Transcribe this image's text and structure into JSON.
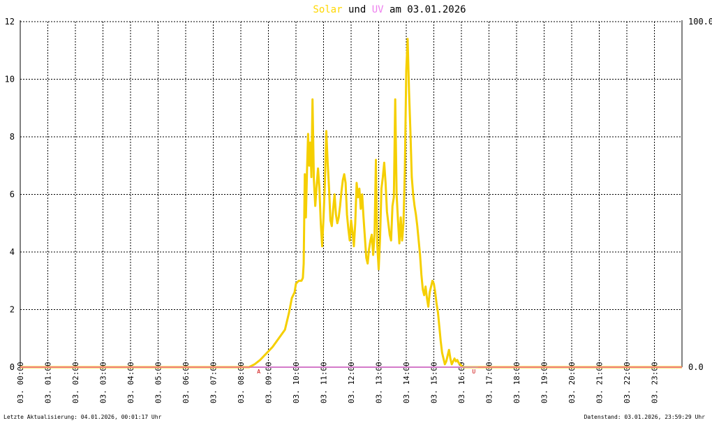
{
  "chart_data": {
    "type": "line",
    "title": {
      "solar": "Solar",
      "und": "und",
      "uv": "UV",
      "rest": "am 03.01.2026"
    },
    "colors": {
      "solar": "#f5cf00",
      "uv": "#d07ad6",
      "zero_line": "#f08080",
      "title_solar": "#ffd700",
      "title_uv": "#ee82ee",
      "marker": "#cc0000"
    },
    "y_left": {
      "min": 0,
      "max": 12,
      "ticks": [
        0,
        2,
        4,
        6,
        8,
        10,
        12
      ]
    },
    "y_right": {
      "ticks": [
        "0.0",
        "100.0"
      ]
    },
    "x_hours_range": [
      0,
      24
    ],
    "x_ticks": [
      "03. 00:00",
      "03. 01:00",
      "03. 02:00",
      "03. 03:00",
      "03. 04:00",
      "03. 05:00",
      "03. 06:00",
      "03. 07:00",
      "03. 08:00",
      "03. 09:00",
      "03. 10:00",
      "03. 11:00",
      "03. 12:00",
      "03. 13:00",
      "03. 14:00",
      "03. 15:00",
      "03. 16:00",
      "03. 17:00",
      "03. 18:00",
      "03. 19:00",
      "03. 20:00",
      "03. 21:00",
      "03. 22:00",
      "03. 23:00"
    ],
    "grid": true,
    "markers": [
      {
        "label": "A",
        "hour": 8.65
      },
      {
        "label": "U",
        "hour": 16.45
      }
    ],
    "series": [
      {
        "name": "Solar",
        "hours": [
          0,
          8.3,
          8.5,
          8.7,
          8.85,
          9.0,
          9.15,
          9.3,
          9.45,
          9.6,
          9.75,
          9.85,
          9.95,
          10.0,
          10.1,
          10.2,
          10.25,
          10.28,
          10.32,
          10.36,
          10.4,
          10.44,
          10.48,
          10.52,
          10.56,
          10.6,
          10.65,
          10.7,
          10.75,
          10.8,
          10.85,
          10.9,
          10.95,
          11.0,
          11.05,
          11.1,
          11.15,
          11.2,
          11.25,
          11.3,
          11.35,
          11.4,
          11.45,
          11.5,
          11.55,
          11.6,
          11.65,
          11.7,
          11.75,
          11.8,
          11.85,
          11.9,
          11.95,
          12.0,
          12.05,
          12.1,
          12.15,
          12.2,
          12.25,
          12.3,
          12.35,
          12.4,
          12.45,
          12.5,
          12.55,
          12.6,
          12.65,
          12.7,
          12.75,
          12.8,
          12.85,
          12.9,
          12.95,
          13.0,
          13.05,
          13.1,
          13.15,
          13.2,
          13.25,
          13.3,
          13.35,
          13.4,
          13.45,
          13.5,
          13.55,
          13.6,
          13.65,
          13.7,
          13.75,
          13.8,
          13.85,
          13.9,
          13.95,
          14.0,
          14.05,
          14.1,
          14.15,
          14.2,
          14.25,
          14.3,
          14.35,
          14.4,
          14.45,
          14.5,
          14.55,
          14.6,
          14.65,
          14.7,
          14.75,
          14.8,
          14.85,
          14.9,
          14.95,
          15.0,
          15.05,
          15.1,
          15.15,
          15.2,
          15.25,
          15.3,
          15.35,
          15.4,
          15.45,
          15.5,
          15.55,
          15.6,
          15.65,
          15.7,
          15.75,
          15.8,
          15.85,
          15.9,
          15.95,
          16.0,
          16.05,
          16.1,
          16.15,
          16.2,
          16.25,
          16.3,
          16.35,
          16.4,
          16.45,
          16.5,
          16.55,
          24
        ],
        "values": [
          0,
          0,
          0.1,
          0.25,
          0.4,
          0.55,
          0.7,
          0.9,
          1.1,
          1.3,
          1.9,
          2.4,
          2.6,
          2.9,
          3.0,
          3.0,
          3.1,
          3.6,
          6.7,
          5.2,
          6.8,
          8.1,
          7.0,
          7.8,
          6.6,
          9.3,
          6.5,
          5.6,
          6.3,
          6.9,
          6.2,
          5.0,
          4.2,
          5.2,
          6.4,
          8.2,
          7.1,
          6.2,
          5.1,
          4.9,
          5.5,
          6.0,
          5.3,
          5.0,
          5.2,
          5.6,
          6.1,
          6.5,
          6.7,
          6.4,
          5.3,
          4.8,
          4.4,
          5.1,
          4.7,
          4.2,
          5.0,
          6.4,
          5.9,
          6.2,
          5.5,
          6.0,
          5.2,
          4.5,
          3.8,
          3.6,
          4.1,
          4.4,
          4.6,
          3.9,
          4.6,
          7.2,
          4.2,
          3.4,
          4.5,
          6.2,
          6.6,
          7.1,
          6.4,
          5.4,
          5.0,
          4.6,
          4.4,
          5.6,
          5.9,
          9.3,
          6.0,
          5.1,
          4.3,
          5.2,
          4.4,
          5.0,
          6.9,
          10.3,
          11.4,
          9.6,
          8.2,
          6.6,
          6.0,
          5.6,
          5.3,
          4.9,
          4.4,
          3.9,
          3.2,
          2.7,
          2.5,
          2.8,
          2.4,
          2.1,
          2.6,
          2.8,
          3.0,
          2.9,
          2.6,
          2.2,
          1.9,
          1.4,
          0.9,
          0.5,
          0.3,
          0.1,
          0.2,
          0.4,
          0.6,
          0.3,
          0.1,
          0.2,
          0.3,
          0.2,
          0.25,
          0.15,
          0.1,
          0.05,
          0,
          0,
          0,
          0,
          0,
          0,
          0,
          0,
          0,
          0,
          0,
          0
        ]
      },
      {
        "name": "UV",
        "hours": [
          0,
          24
        ],
        "values": [
          0,
          0
        ]
      }
    ]
  },
  "footer": {
    "left": "Letzte Aktualisierung: 04.01.2026, 00:01:17 Uhr",
    "right": "Datenstand: 03.01.2026, 23:59:29 Uhr"
  }
}
